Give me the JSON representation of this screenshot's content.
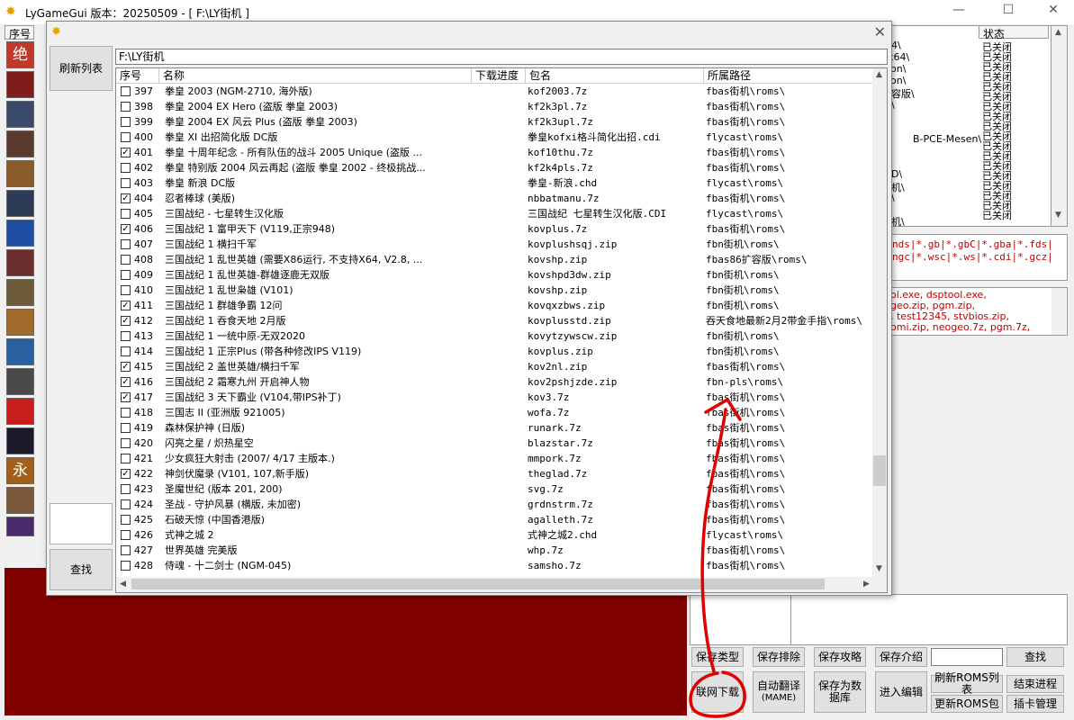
{
  "window": {
    "title": "LyGameGui 版本：20250509  - [ F:\\LY街机 ]",
    "minimize": "—",
    "maximize": "☐",
    "close": "✕"
  },
  "left_column": {
    "header": "序号",
    "avatars": [
      "绝",
      "",
      "",
      "",
      "",
      "",
      "",
      "",
      "",
      "",
      "",
      "",
      "",
      "",
      "永",
      "",
      ""
    ]
  },
  "status_panel": {
    "header": "状态",
    "items": [
      "已关闭",
      "已关闭",
      "已关闭",
      "已关闭",
      "已关闭",
      "已关闭",
      "已关闭",
      "已关闭",
      "已关闭",
      "已关闭",
      "已关闭",
      "已关闭",
      "已关闭",
      "已关闭",
      "已关闭",
      "已关闭",
      "已关闭",
      "已关闭"
    ],
    "path_fragments": [
      "4\\",
      "x64\\",
      "ion\\",
      "ion\\",
      "容版\\",
      "\\",
      "B-PCE-Mesen\\",
      "D\\",
      "机\\",
      "\\",
      "机\\"
    ]
  },
  "ext_panel": {
    "line1": "nds|*.gb|*.gbC|*.gba|*.fds|",
    "line2": "ngc|*.wsc|*.ws|*.cdi|*.gcz|"
  },
  "files_panel": {
    "lines": [
      "ol.exe, dsptool.exe,",
      "geo.zip, pgm.zip,",
      ", test12345, stvbios.zip,",
      "omi.zip, neogeo.7z, pgm.7z,"
    ]
  },
  "bottom_buttons": {
    "save_type": "保存类型",
    "save_exclude": "保存排除",
    "save_guide": "保存攻略",
    "save_intro": "保存介绍",
    "search": "查找",
    "online_download": "联网下载",
    "auto_translate_1": "自动翻译",
    "auto_translate_2": "(MAME)",
    "save_db_1": "保存为数",
    "save_db_2": "据库",
    "enter_edit": "进入编辑",
    "refresh_roms": "刷新ROMS列表",
    "end_process": "结束进程",
    "update_roms": "更新ROMS包",
    "card_manage": "插卡管理"
  },
  "dialog": {
    "close": "✕",
    "refresh_button": "刷新列表",
    "find_button": "查找",
    "path": "F:\\LY街机",
    "columns": {
      "num": "序号",
      "name": "名称",
      "progress": "下载进度",
      "package": "包名",
      "path": "所属路径"
    },
    "rows": [
      {
        "num": "397",
        "checked": false,
        "name": "拳皇 2003 (NGM-2710, 海外版)",
        "package": "kof2003.7z",
        "path": "fbas街机\\roms\\"
      },
      {
        "num": "398",
        "checked": false,
        "name": "拳皇 2004 EX Hero (盗版 拳皇 2003)",
        "package": "kf2k3pl.7z",
        "path": "fbas街机\\roms\\"
      },
      {
        "num": "399",
        "checked": false,
        "name": "拳皇 2004 EX 风云 Plus (盗版 拳皇 2003)",
        "package": "kf2k3upl.7z",
        "path": "fbas街机\\roms\\"
      },
      {
        "num": "400",
        "checked": false,
        "name": "拳皇 XI 出招简化版 DC版",
        "package": "拳皇kofxi格斗简化出招.cdi",
        "path": "flycast\\roms\\"
      },
      {
        "num": "401",
        "checked": true,
        "name": "拳皇 十周年纪念 - 所有队伍的战斗 2005 Unique (盗版 ...",
        "package": "kof10thu.7z",
        "path": "fbas街机\\roms\\"
      },
      {
        "num": "402",
        "checked": false,
        "name": "拳皇 特别版 2004 风云再起 (盗版 拳皇 2002 - 终极挑战...",
        "package": "kf2k4pls.7z",
        "path": "fbas街机\\roms\\"
      },
      {
        "num": "403",
        "checked": false,
        "name": "拳皇 新浪 DC版",
        "package": "拳皇-新浪.chd",
        "path": "flycast\\roms\\"
      },
      {
        "num": "404",
        "checked": true,
        "name": "忍者棒球 (美版)",
        "package": "nbbatmanu.7z",
        "path": "fbas街机\\roms\\"
      },
      {
        "num": "405",
        "checked": false,
        "name": "三国战纪 - 七星转生汉化版",
        "package": "三国战纪 七星转生汉化版.CDI",
        "path": "flycast\\roms\\"
      },
      {
        "num": "406",
        "checked": true,
        "name": "三国战纪 1 富甲天下 (V119,正宗948)",
        "package": "kovplus.7z",
        "path": "fbas街机\\roms\\"
      },
      {
        "num": "407",
        "checked": false,
        "name": "三国战纪 1 横扫千军",
        "package": "kovplushsqj.zip",
        "path": "fbn街机\\roms\\"
      },
      {
        "num": "408",
        "checked": false,
        "name": "三国战纪 1 乱世英雄 (需要X86运行, 不支持X64, V2.8, ...",
        "package": "kovshp.zip",
        "path": "fbas86扩容版\\roms\\"
      },
      {
        "num": "409",
        "checked": false,
        "name": "三国战纪 1 乱世英雄-群雄逐鹿无双版",
        "package": "kovshpd3dw.zip",
        "path": "fbn街机\\roms\\"
      },
      {
        "num": "410",
        "checked": false,
        "name": "三国战纪 1 乱世枭雄 (V101)",
        "package": "kovshp.zip",
        "path": "fbn街机\\roms\\"
      },
      {
        "num": "411",
        "checked": true,
        "name": "三国战纪 1 群雄争霸 12问",
        "package": "kovqxzbws.zip",
        "path": "fbn街机\\roms\\"
      },
      {
        "num": "412",
        "checked": true,
        "name": "三国战纪 1 吞食天地 2月版",
        "package": "kovplusstd.zip",
        "path": "吞天食地最新2月2带金手指\\roms\\"
      },
      {
        "num": "413",
        "checked": false,
        "name": "三国战纪 1 一统中原-无双2020",
        "package": "kovytzywscw.zip",
        "path": "fbn街机\\roms\\"
      },
      {
        "num": "414",
        "checked": false,
        "name": "三国战纪 1 正宗Plus (带各种修改IPS V119)",
        "package": "kovplus.zip",
        "path": "fbn街机\\roms\\"
      },
      {
        "num": "415",
        "checked": true,
        "name": "三国战纪 2 盖世英雄/横扫千军",
        "package": "kov2nl.zip",
        "path": "fbas街机\\roms\\"
      },
      {
        "num": "416",
        "checked": true,
        "name": "三国战纪 2 霜寒九州 开启神人物",
        "package": "kov2pshjzde.zip",
        "path": "fbn-pls\\roms\\"
      },
      {
        "num": "417",
        "checked": true,
        "name": "三国战纪 3 天下霸业 (V104,带IPS补丁)",
        "package": "kov3.7z",
        "path": "fbas街机\\roms\\"
      },
      {
        "num": "418",
        "checked": false,
        "name": "三国志 II (亚洲版 921005)",
        "package": "wofa.7z",
        "path": "fbas街机\\roms\\"
      },
      {
        "num": "419",
        "checked": false,
        "name": "森林保护神 (日版)",
        "package": "runark.7z",
        "path": "fbas街机\\roms\\"
      },
      {
        "num": "420",
        "checked": false,
        "name": "闪亮之星 / 炽热星空",
        "package": "blazstar.7z",
        "path": "fbas街机\\roms\\"
      },
      {
        "num": "421",
        "checked": false,
        "name": "少女疯狂大射击 (2007/ 4/17 主版本.)",
        "package": "mmpork.7z",
        "path": "fbas街机\\roms\\"
      },
      {
        "num": "422",
        "checked": true,
        "name": "神剑伏魔录 (V101, 107,新手版)",
        "package": "theglad.7z",
        "path": "fbas街机\\roms\\"
      },
      {
        "num": "423",
        "checked": false,
        "name": "圣魔世纪 (版本 201, 200)",
        "package": "svg.7z",
        "path": "fbas街机\\roms\\"
      },
      {
        "num": "424",
        "checked": false,
        "name": "圣战 - 守护风暴 (横版, 未加密)",
        "package": "grdnstrm.7z",
        "path": "fbas街机\\roms\\"
      },
      {
        "num": "425",
        "checked": false,
        "name": "石破天惊 (中国香港版)",
        "package": "agalleth.7z",
        "path": "fbas街机\\roms\\"
      },
      {
        "num": "426",
        "checked": false,
        "name": "式神之城 2",
        "package": "式神之城2.chd",
        "path": "flycast\\roms\\"
      },
      {
        "num": "427",
        "checked": false,
        "name": "世界英雄 完美版",
        "package": "whp.7z",
        "path": "fbas街机\\roms\\"
      },
      {
        "num": "428",
        "checked": false,
        "name": "侍魂 - 十二剑士 (NGM-045)",
        "package": "samsho.7z",
        "path": "fbas街机\\roms\\"
      }
    ],
    "vscroll_fraction": 0.83,
    "hscroll_fraction": 0.0
  },
  "colors": {
    "annotation_red": "#e00000",
    "dark_red_panel": "#800000"
  }
}
